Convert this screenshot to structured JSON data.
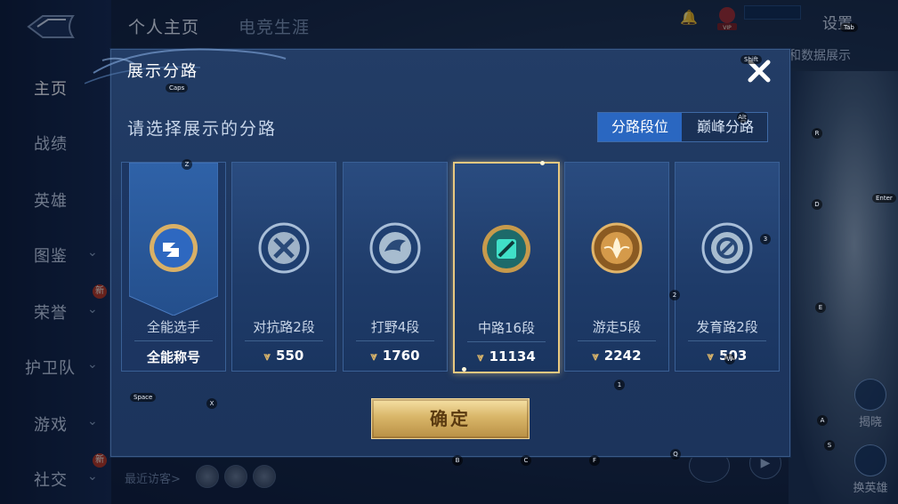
{
  "nav": {
    "items": [
      {
        "label": "主页",
        "has_chevron": false,
        "new": false
      },
      {
        "label": "战绩",
        "has_chevron": false,
        "new": false
      },
      {
        "label": "英雄",
        "has_chevron": false,
        "new": false
      },
      {
        "label": "图鉴",
        "has_chevron": true,
        "new": false
      },
      {
        "label": "荣誉",
        "has_chevron": true,
        "new": true
      },
      {
        "label": "护卫队",
        "has_chevron": true,
        "new": false
      },
      {
        "label": "游戏",
        "has_chevron": true,
        "new": false
      },
      {
        "label": "社交",
        "has_chevron": true,
        "new": true
      }
    ],
    "new_badge": "新"
  },
  "top": {
    "tab_personal": "个人主页",
    "tab_esports": "电竞生涯",
    "settings": "设置",
    "side_label": "和数据展示",
    "vip": "VIP"
  },
  "bottom": {
    "visitors_label": "最近访客>"
  },
  "side": {
    "btn1": "揭晓",
    "btn2": "换英雄"
  },
  "dialog": {
    "title": "展示分路",
    "subtitle": "请选择展示的分路",
    "seg_lane_rank": "分路段位",
    "seg_peak_lane": "巅峰分路",
    "confirm": "确定",
    "cards": [
      {
        "name": "全能选手",
        "value": "全能称号",
        "icon": "all-round-badge-icon",
        "selected": false
      },
      {
        "name": "对抗路2段",
        "value": "550",
        "icon": "clash-lane-badge-icon",
        "selected": false
      },
      {
        "name": "打野4段",
        "value": "1760",
        "icon": "jungle-badge-icon",
        "selected": false
      },
      {
        "name": "中路16段",
        "value": "11134",
        "icon": "mid-lane-badge-icon",
        "selected": true
      },
      {
        "name": "游走5段",
        "value": "2242",
        "icon": "roam-badge-icon",
        "selected": false
      },
      {
        "name": "发育路2段",
        "value": "503",
        "icon": "farm-lane-badge-icon",
        "selected": false
      }
    ]
  },
  "hints": [
    "Caps",
    "Z",
    "Shift",
    "Alt",
    "R",
    "D",
    "Enter",
    "3",
    "2",
    "E",
    "1",
    "Space",
    "X",
    "A",
    "S",
    "B",
    "C",
    "F",
    "Q",
    "Tab",
    "W"
  ],
  "colors": {
    "dialog_bg": "#1e3760",
    "segment_on": "#2a67c1",
    "confirm_gold": "#d9b669",
    "selected_border": "#e8c880"
  }
}
